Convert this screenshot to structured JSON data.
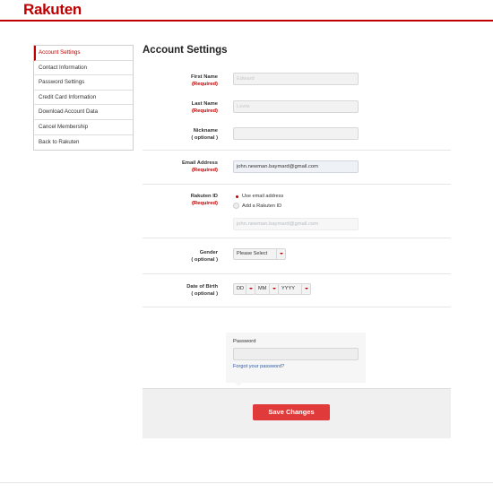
{
  "brand": {
    "logo": "Rakuten",
    "accent": "#bf0000",
    "button_color": "#e03a3a"
  },
  "sidebar": {
    "items": [
      {
        "label": "Account Settings",
        "active": true
      },
      {
        "label": "Contact Information"
      },
      {
        "label": "Password Settings"
      },
      {
        "label": "Credit Card Information"
      },
      {
        "label": "Download Account Data"
      },
      {
        "label": "Cancel Membership"
      },
      {
        "label": "Back to Rakuten"
      }
    ]
  },
  "page": {
    "title": "Account Settings"
  },
  "form": {
    "first_name": {
      "label": "First Name",
      "tag": "(Required)",
      "value": "Edward"
    },
    "last_name": {
      "label": "Last Name",
      "tag": "(Required)",
      "value": "Lewis"
    },
    "nickname": {
      "label": "Nickname",
      "tag": "( optional )",
      "value": ""
    },
    "email": {
      "label": "Email Address",
      "tag": "(Required)",
      "value": "john.newman.baymard@gmail.com"
    },
    "rakuten_id": {
      "label": "Rakuten ID",
      "tag": "(Required)",
      "option_email": "Use email address",
      "option_id": "Add a Rakuten ID",
      "value": "john.newman.baymard@gmail.com"
    },
    "gender": {
      "label": "Gender",
      "tag": "( optional )",
      "selected": "Please Select"
    },
    "dob": {
      "label": "Date of Birth",
      "tag": "( optional )",
      "day": "DD",
      "month": "MM",
      "year": "YYYY"
    }
  },
  "password": {
    "label": "Password",
    "forgot_link": "Forgot your password?"
  },
  "actions": {
    "save_label": "Save Changes"
  }
}
